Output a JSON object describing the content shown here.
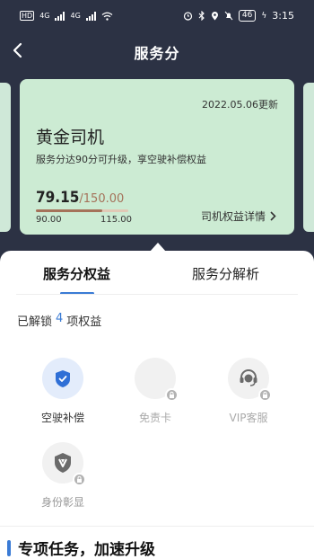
{
  "status_bar": {
    "signal_left": "HD",
    "net_1": "4G",
    "net_2": "4G",
    "battery": "46",
    "time": "3:15"
  },
  "header": {
    "title": "服务分",
    "back_icon": "chevron-left-icon"
  },
  "card": {
    "date": "2022.05.06更新",
    "level": "黄金司机",
    "description": "服务分达90分可升级，享空驶补偿权益",
    "score": "79.15",
    "score_max": "/150.00",
    "progress_fraction": 0.72,
    "range_start": "90.00",
    "range_end": "115.00",
    "detail_link": "司机权益详情",
    "colors": {
      "card_bg": "#ccebd3",
      "accent": "#a5725a"
    }
  },
  "tabs": [
    {
      "label": "服务分权益",
      "active": true
    },
    {
      "label": "服务分解析",
      "active": false
    }
  ],
  "unlocked": {
    "prefix": "已解锁",
    "count": "4",
    "suffix": "项权益"
  },
  "benefits": [
    {
      "label": "空驶补偿",
      "icon": "shield-check-icon",
      "unlocked": true
    },
    {
      "label": "免责卡",
      "icon": "card-icon",
      "unlocked": false
    },
    {
      "label": "VIP客服",
      "icon": "headset-icon",
      "unlocked": false
    },
    {
      "label": "身份彰显",
      "icon": "badge-icon",
      "unlocked": false
    }
  ],
  "section": {
    "title": "专项任务，加速升级"
  }
}
